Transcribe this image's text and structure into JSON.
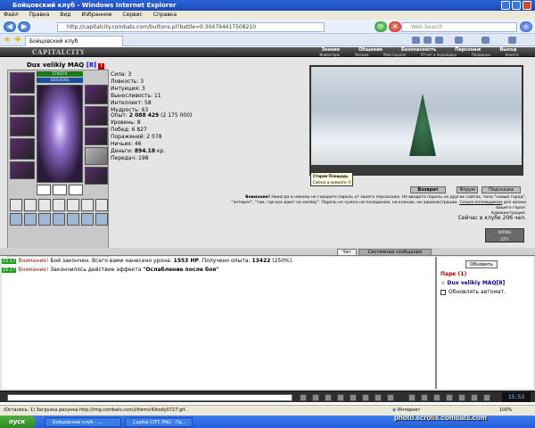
{
  "browser": {
    "title": "Бойцовский клуб - Windows Internet Explorer",
    "menu": [
      "Файл",
      "Правка",
      "Вид",
      "Избранное",
      "Сервис",
      "Справка"
    ],
    "address": "http://capitalcity.combats.com/buttons.pl?battle=0.304794417508210",
    "search_placeholder": "Web Search",
    "tab_label": "Бойцовский клуб"
  },
  "game": {
    "logo": "CAPITALCITY",
    "nav_top": [
      "Знания",
      "Общение",
      "Безопасность",
      "Персонаж",
      "Выход"
    ],
    "nav_sub": [
      "Инвентарь",
      "Умения",
      "Мой Скролл",
      "Отчет о переводах",
      "Поединки",
      "Анкета"
    ],
    "character": {
      "name": "Dux velikiy MAQ",
      "level": "[8]",
      "hp": "274/274",
      "mp": "1001/1001"
    },
    "stats": [
      "Сила: 3",
      "Ловкость: 3",
      "Интуиция: 3",
      "Выносливость: 11",
      "Интеллект: 58",
      "Мудрость: 63"
    ],
    "progress": {
      "exp_label": "Опыт:",
      "exp": "2 088 429",
      "exp_next": "(2 175 000)",
      "level": "Уровень: 8",
      "wins": "Побед: 6 827",
      "losses": "Поражений: 2 078",
      "draws": "Ничьих: 46",
      "money_label": "Деньги:",
      "money": "894.18",
      "money_unit": "кр.",
      "transfers": "Передач: 198"
    },
    "location": {
      "name": "Старая Площадь",
      "occupancy": "Сейчас в комнате: 0"
    },
    "buttons": {
      "return": "Возврат",
      "forum": "Форум",
      "hint": "Подсказка"
    },
    "notice": {
      "warn": "Внимание!",
      "text1": "Никогда и никому не говорите пароль от своего персонажа. Не вводите пароль на других сайтах, типа \"новый город\",",
      "text2": "\"лотерея\", \"там, где все дают на халяву\". Пароль не нужен ни паладинам, ни кланам, ни администрации,",
      "link": "только взломщикам",
      "text3": "для кражи",
      "text4": "вашего героя.",
      "sign": "Администрация."
    },
    "online": "Сейчас в клубе 206 чел.",
    "counter": [
      "RATING",
      "CITY"
    ],
    "chat_tabs": [
      "Чат",
      "Системные сообщения"
    ],
    "chat": [
      {
        "time": "15:17",
        "warn": "Внимание!",
        "text1": "Бой закончен. Всего вами нанесено урона:",
        "dmg": "1553 HP",
        "text2": ". Получено опыта:",
        "exp": "13422",
        "text3": "(250%)."
      },
      {
        "time": "15:17",
        "warn": "Внимание!",
        "text1": "Закончилось действие эффекта",
        "effect": "\"Ослабление после боя\""
      }
    ],
    "side": {
      "refresh": "Обновить",
      "room": "Парк (1)",
      "user": "Dux velikiy MAQ",
      "user_level": "[8]",
      "autorefresh": "Обновлять автомат."
    },
    "clock": "15:53"
  },
  "status": {
    "text": "(Осталось: 1) Загрузка рисунка http://img.combats.com/i/items/4/body0727.gif...",
    "zone": "Интернет",
    "zoom": "100%"
  },
  "taskbar": {
    "start": "пуск",
    "tasks": [
      "Бойцовский клуб - ...",
      "Capital CITY. PNG - Пр..."
    ]
  },
  "watermark": "photo.scrolls.combats.com"
}
